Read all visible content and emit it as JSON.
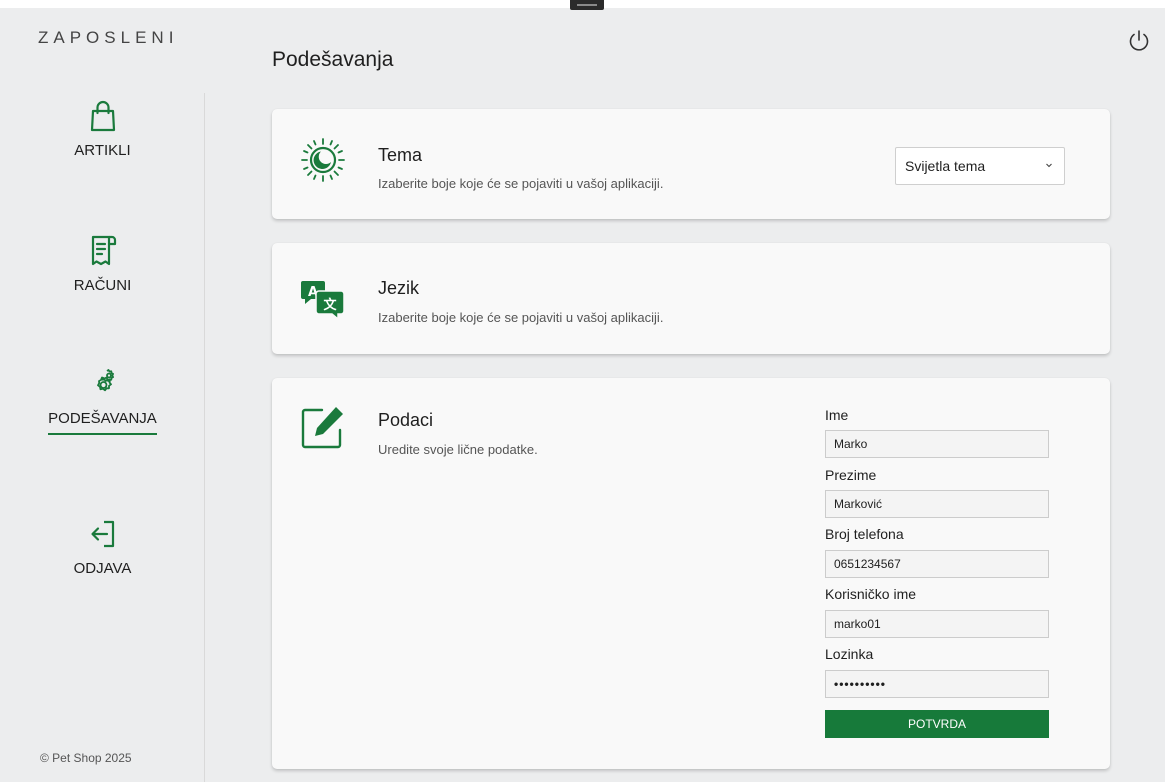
{
  "app": {
    "brand": "ZAPOSLENI",
    "copyright": "© Pet Shop 2025"
  },
  "sidebar": {
    "items": [
      {
        "label": "ARTIKLI",
        "icon": "shopping-bag-icon"
      },
      {
        "label": "RAČUNI",
        "icon": "receipt-icon"
      },
      {
        "label": "PODEŠAVANJA",
        "icon": "gears-icon",
        "active": true
      },
      {
        "label": "ODJAVA",
        "icon": "logout-icon"
      }
    ]
  },
  "header": {
    "title": "Podešavanja",
    "power_icon": "power-icon"
  },
  "theme": {
    "title": "Tema",
    "description": "Izaberite boje koje će se pojaviti u vašoj aplikaciji.",
    "selected": "Svijetla tema",
    "icon": "theme-icon"
  },
  "language": {
    "title": "Jezik",
    "description": "Izaberite boje koje će se pojaviti u vašoj aplikaciji.",
    "icon": "translate-icon"
  },
  "profile": {
    "title": "Podaci",
    "description": "Uredite svoje lične podatke.",
    "icon": "edit-icon",
    "fields": [
      {
        "label": "Ime",
        "value": "Marko"
      },
      {
        "label": "Prezime",
        "value": "Marković"
      },
      {
        "label": "Broj telefona",
        "value": "0651234567"
      },
      {
        "label": "Korisničko ime",
        "value": "marko01"
      },
      {
        "label": "Lozinka",
        "value": "••••••••••"
      }
    ],
    "submit_label": "POTVRDA"
  },
  "colors": {
    "accent": "#177a3a",
    "background": "#ecedee",
    "card": "#f9f9f9"
  }
}
